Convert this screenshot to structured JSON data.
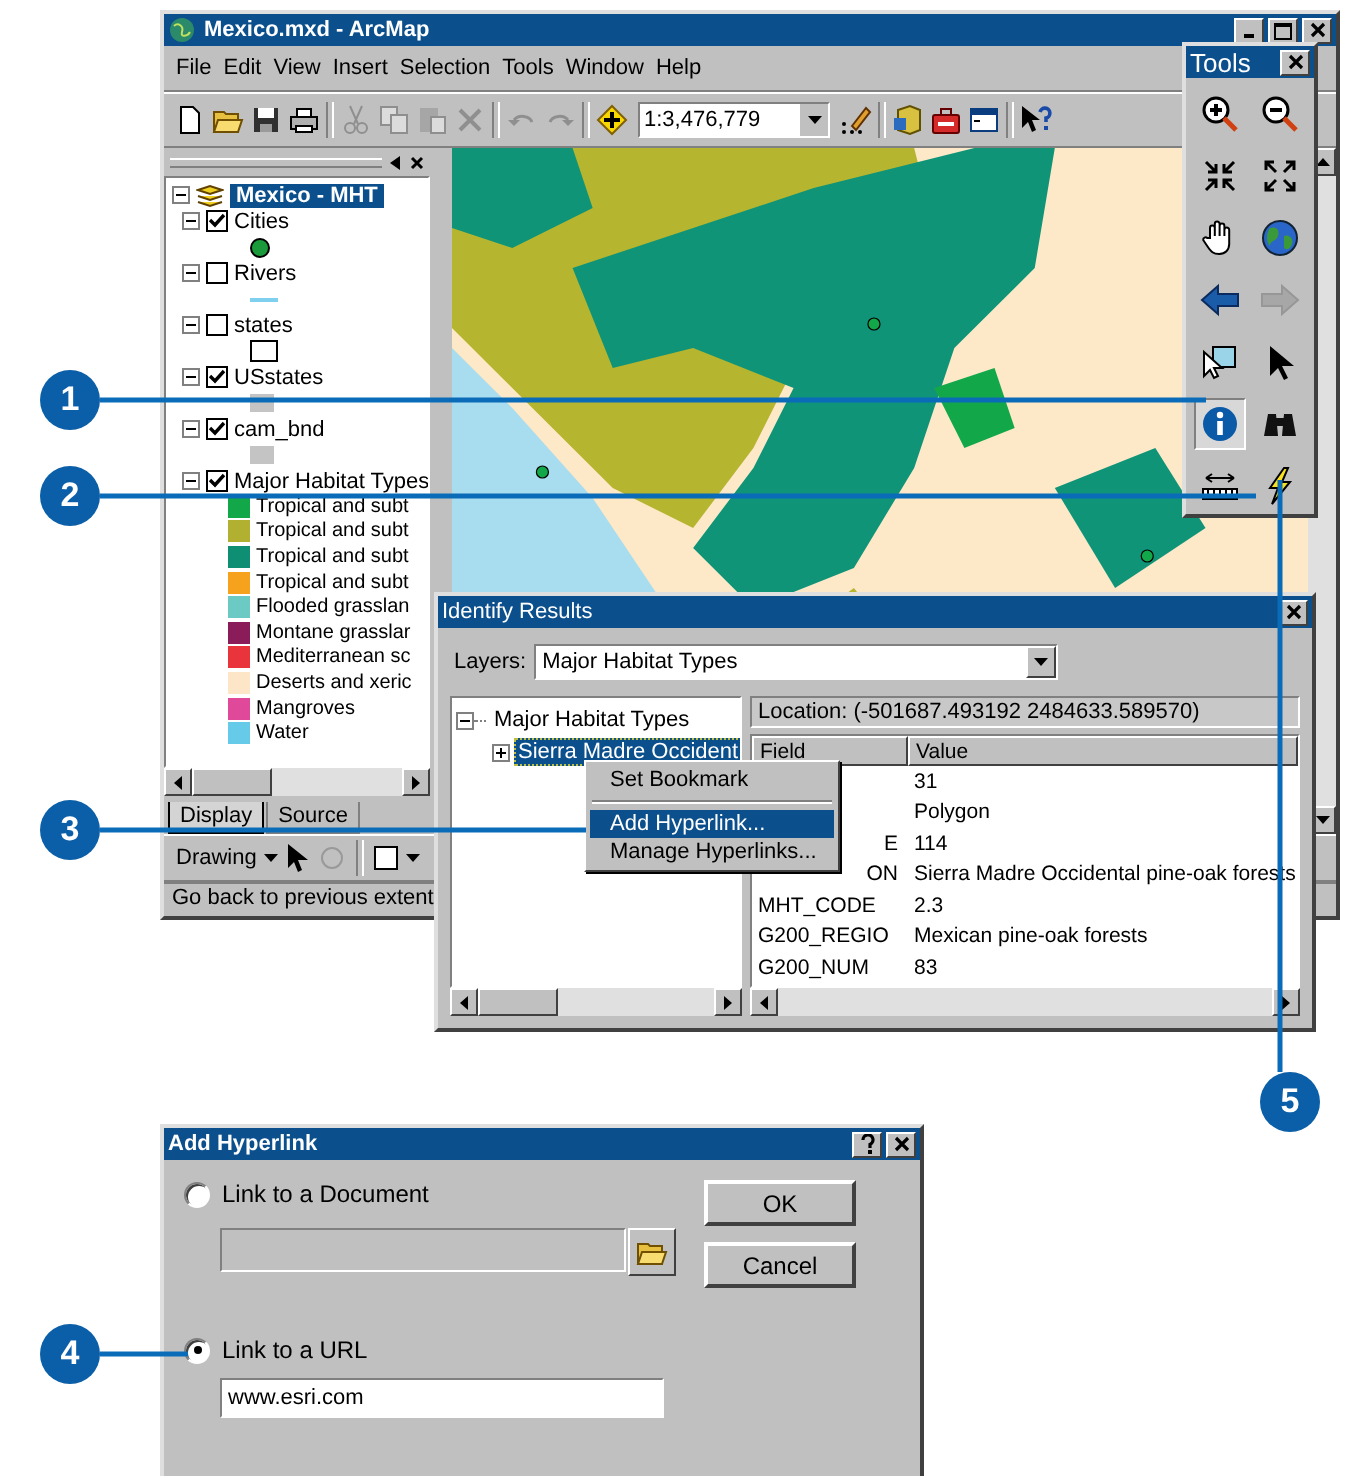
{
  "arcmap": {
    "title": "Mexico.mxd - ArcMap",
    "menu": [
      "File",
      "Edit",
      "View",
      "Insert",
      "Selection",
      "Tools",
      "Window",
      "Help"
    ],
    "toolbar": [
      {
        "kind": "new",
        "disabled": false
      },
      {
        "kind": "open",
        "disabled": false
      },
      {
        "kind": "save",
        "disabled": false
      },
      {
        "kind": "print",
        "disabled": false
      },
      {
        "kind": "separator"
      },
      {
        "kind": "cut",
        "disabled": true
      },
      {
        "kind": "copy",
        "disabled": true
      },
      {
        "kind": "paste",
        "disabled": true
      },
      {
        "kind": "delete",
        "disabled": true
      },
      {
        "kind": "separator"
      },
      {
        "kind": "undo",
        "disabled": true
      },
      {
        "kind": "redo",
        "disabled": true
      },
      {
        "kind": "separator"
      },
      {
        "kind": "add",
        "disabled": false
      },
      {
        "kind": "scale",
        "value": "1:3,476,779"
      },
      {
        "kind": "editor",
        "disabled": false
      },
      {
        "kind": "separator"
      },
      {
        "kind": "catalog",
        "disabled": false
      },
      {
        "kind": "toolbox",
        "disabled": false
      },
      {
        "kind": "command",
        "disabled": false
      },
      {
        "kind": "separator"
      },
      {
        "kind": "help",
        "disabled": false
      }
    ],
    "toc": {
      "root": {
        "label": "Mexico - MHT",
        "selected": true,
        "expanded": true
      },
      "layers": [
        {
          "name": "Cities",
          "checked": true,
          "expanded": true,
          "symbol": {
            "kind": "point",
            "color": "#1a9a3a"
          }
        },
        {
          "name": "Rivers",
          "checked": false,
          "expanded": true,
          "symbol": {
            "kind": "line",
            "color": "#7fd0ef"
          }
        },
        {
          "name": "states",
          "checked": false,
          "expanded": true,
          "symbol": {
            "kind": "polygon",
            "color": "#ffffff"
          }
        },
        {
          "name": "USstates",
          "checked": true,
          "expanded": true,
          "symbol": {
            "kind": "polygon",
            "color": "#c4c4c4"
          }
        },
        {
          "name": "cam_bnd",
          "checked": true,
          "expanded": true,
          "symbol": {
            "kind": "polygon",
            "color": "#c4c4c4"
          }
        },
        {
          "name": "Major Habitat Types",
          "checked": true,
          "expanded": true,
          "legend": [
            {
              "label": "Tropical and subt",
              "color": "#12a84a"
            },
            {
              "label": "Tropical and subt",
              "color": "#b2b030"
            },
            {
              "label": "Tropical and subt",
              "color": "#0e8f74"
            },
            {
              "label": "Tropical and subt",
              "color": "#f7a21c"
            },
            {
              "label": "Flooded grasslan",
              "color": "#6ccac4"
            },
            {
              "label": "Montane grasslar",
              "color": "#8a1c5a"
            },
            {
              "label": "Mediterranean sc",
              "color": "#e8343a"
            },
            {
              "label": "Deserts and xeric",
              "color": "#fde6c8"
            },
            {
              "label": "Mangroves",
              "color": "#e0489a"
            },
            {
              "label": "Water",
              "color": "#66cbe8"
            }
          ]
        }
      ]
    },
    "tabs": [
      {
        "label": "Display",
        "selected": true
      },
      {
        "label": "Source",
        "selected": false
      }
    ],
    "drawing_toolbar": {
      "label": "Drawing"
    },
    "status_bar": "Go back to previous extent"
  },
  "tools": {
    "title": "Tools",
    "buttons": [
      {
        "kind": "zoom-in",
        "pressed": false,
        "disabled": false
      },
      {
        "kind": "zoom-out",
        "pressed": false,
        "disabled": false
      },
      {
        "kind": "fixed-in",
        "pressed": false,
        "disabled": false
      },
      {
        "kind": "fixed-out",
        "pressed": false,
        "disabled": false
      },
      {
        "kind": "pan",
        "pressed": false,
        "disabled": false
      },
      {
        "kind": "full",
        "pressed": false,
        "disabled": false
      },
      {
        "kind": "back",
        "pressed": false,
        "disabled": false
      },
      {
        "kind": "forward",
        "pressed": false,
        "disabled": true
      },
      {
        "kind": "select-features",
        "pressed": false,
        "disabled": false
      },
      {
        "kind": "select",
        "pressed": false,
        "disabled": false
      },
      {
        "kind": "identify",
        "pressed": true,
        "disabled": false
      },
      {
        "kind": "find",
        "pressed": false,
        "disabled": false
      },
      {
        "kind": "measure",
        "pressed": false,
        "disabled": false
      },
      {
        "kind": "hyperlink",
        "pressed": false,
        "disabled": false
      }
    ]
  },
  "identify": {
    "title": "Identify Results",
    "layers_label": "Layers:",
    "layers_value": "Major Habitat Types",
    "tree": {
      "label": "Major Habitat Types",
      "expanded": true,
      "children": [
        {
          "label": "Sierra Madre Occident",
          "selected": true,
          "expanded": false
        }
      ]
    },
    "location": "Location: (-501687.493192  2484633.589570)",
    "columns": [
      "Field",
      "Value"
    ],
    "rows": [
      {
        "value": "31"
      },
      {
        "value": "Polygon"
      },
      {
        "field": "E",
        "value": "114"
      },
      {
        "field": "ON",
        "value": "Sierra Madre Occidental pine-oak forests"
      },
      {
        "field": "MHT_CODE",
        "value": "2.3"
      },
      {
        "field": "G200_REGIO",
        "value": "Mexican pine-oak forests"
      },
      {
        "field": "G200_NUM",
        "value": "83"
      }
    ],
    "context_menu": [
      {
        "kind": "item",
        "label": "Set Bookmark",
        "selected": false
      },
      {
        "kind": "separator"
      },
      {
        "kind": "item",
        "label": "Add Hyperlink...",
        "selected": true
      },
      {
        "kind": "item",
        "label": "Manage Hyperlinks...",
        "selected": false
      }
    ]
  },
  "dialog": {
    "title": "Add Hyperlink",
    "options": [
      {
        "label": "Link to a Document",
        "selected": false
      },
      {
        "label": "Link to a URL",
        "selected": true
      }
    ],
    "document_field": {
      "disabled": true
    },
    "url_field": {
      "value": "www.esri.com"
    },
    "buttons": [
      "OK",
      "Cancel"
    ]
  },
  "callouts": [
    "1",
    "2",
    "3",
    "4",
    "5"
  ]
}
